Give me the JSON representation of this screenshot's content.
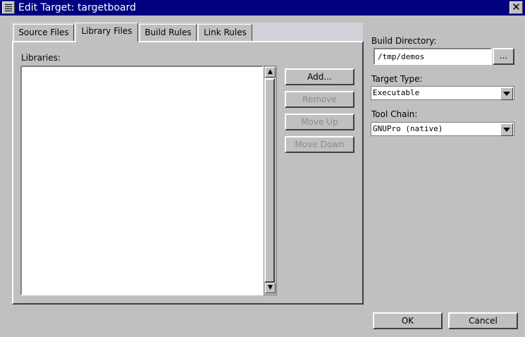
{
  "window": {
    "title": "Edit Target: targetboard",
    "close_glyph": "✕"
  },
  "tabs": [
    {
      "label": "Source Files",
      "mnemonic": "S"
    },
    {
      "label": "Library Files",
      "mnemonic": "L"
    },
    {
      "label": "Build Rules",
      "mnemonic": "B"
    },
    {
      "label": "Link Rules",
      "mnemonic": "R"
    }
  ],
  "active_tab": "Library Files",
  "libraries": {
    "label": "Libraries:",
    "items": []
  },
  "list_buttons": {
    "add": "Add...",
    "remove": "Remove",
    "move_up": "Move Up",
    "move_down": "Move Down"
  },
  "build_directory": {
    "label": "Build Directory:",
    "value": "/tmp/demos",
    "browse": "..."
  },
  "target_type": {
    "label": "Target Type:",
    "value": "Executable"
  },
  "tool_chain": {
    "label": "Tool Chain:",
    "value": "GNUPro (native)"
  },
  "dialog_buttons": {
    "ok": "OK",
    "cancel": "Cancel"
  },
  "scroll_arrows": {
    "up": "▲",
    "down": "▼"
  }
}
